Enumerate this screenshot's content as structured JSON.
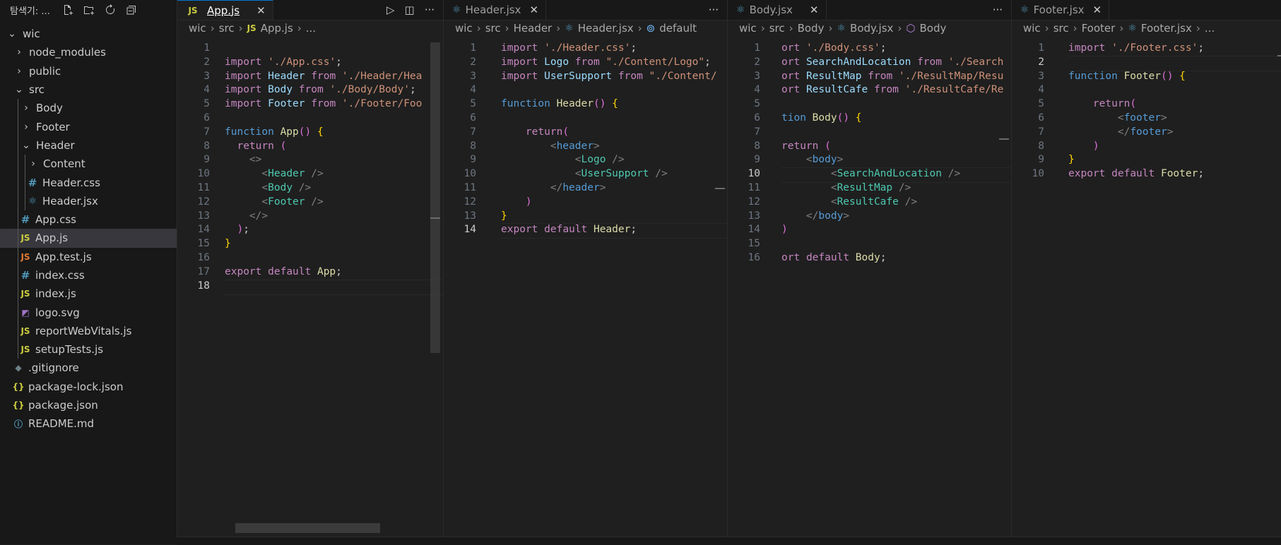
{
  "explorer": {
    "title": "탐색기: ...",
    "root": "wic",
    "items": [
      {
        "label": "node_modules",
        "kind": "folder"
      },
      {
        "label": "public",
        "kind": "folder"
      },
      {
        "label": "src",
        "kind": "folder-open"
      },
      {
        "label": "Body",
        "kind": "folder"
      },
      {
        "label": "Footer",
        "kind": "folder"
      },
      {
        "label": "Header",
        "kind": "folder-open"
      },
      {
        "label": "Content",
        "kind": "folder"
      },
      {
        "label": "Header.css",
        "kind": "css"
      },
      {
        "label": "Header.jsx",
        "kind": "react"
      },
      {
        "label": "App.css",
        "kind": "css"
      },
      {
        "label": "App.js",
        "kind": "js",
        "selected": true
      },
      {
        "label": "App.test.js",
        "kind": "js-test"
      },
      {
        "label": "index.css",
        "kind": "css"
      },
      {
        "label": "index.js",
        "kind": "js"
      },
      {
        "label": "logo.svg",
        "kind": "svg"
      },
      {
        "label": "reportWebVitals.js",
        "kind": "js"
      },
      {
        "label": "setupTests.js",
        "kind": "js"
      },
      {
        "label": ".gitignore",
        "kind": "git"
      },
      {
        "label": "package-lock.json",
        "kind": "json"
      },
      {
        "label": "package.json",
        "kind": "json"
      },
      {
        "label": "README.md",
        "kind": "info"
      }
    ]
  },
  "panes": [
    {
      "tab": "App.js",
      "tab_icon": "JS",
      "crumbs": [
        "wic",
        "src",
        "App.js",
        "..."
      ],
      "crumb_icon_index": 2,
      "crumb_icon": "JS",
      "lines": [
        "",
        "import './App.css';",
        "import Header from './Header/Hea",
        "import Body from './Body/Body';",
        "import Footer from './Footer/Foo",
        "",
        "function App() {",
        "  return (",
        "    <>",
        "      <Header />",
        "      <Body />",
        "      <Footer />",
        "    </>",
        "  );",
        "}",
        "",
        "export default App;",
        ""
      ],
      "current_line": 18
    },
    {
      "tab": "Header.jsx",
      "tab_icon": "react",
      "crumbs": [
        "wic",
        "src",
        "Header",
        "Header.jsx",
        "default"
      ],
      "lines": [
        "import './Header.css';",
        "import Logo from \"./Content/Logo\";",
        "import UserSupport from \"./Content/",
        "",
        "function Header() {",
        "",
        "    return(",
        "        <header>",
        "            <Logo />",
        "            <UserSupport />",
        "        </header>",
        "    )",
        "}",
        "export default Header;"
      ],
      "current_line": 14
    },
    {
      "tab": "Body.jsx",
      "tab_icon": "react",
      "crumbs": [
        "wic",
        "src",
        "Body",
        "Body.jsx",
        "Body"
      ],
      "lines": [
        "ort './Body.css';",
        "ort SearchAndLocation from './Search",
        "ort ResultMap from './ResultMap/Resu",
        "ort ResultCafe from './ResultCafe/Re",
        "",
        "tion Body() {",
        "",
        "return (",
        "    <body>",
        "        <SearchAndLocation />",
        "        <ResultMap />",
        "        <ResultCafe />",
        "    </body>",
        ")",
        "",
        "ort default Body;"
      ],
      "current_line": 10
    },
    {
      "tab": "Footer.jsx",
      "tab_icon": "react",
      "crumbs": [
        "wic",
        "src",
        "Footer",
        "Footer.jsx",
        "..."
      ],
      "lines": [
        "import './Footer.css';",
        "",
        "function Footer() {",
        "",
        "    return(",
        "        <footer>",
        "        </footer>",
        "    )",
        "}",
        "export default Footer;"
      ],
      "current_line": 2
    }
  ]
}
